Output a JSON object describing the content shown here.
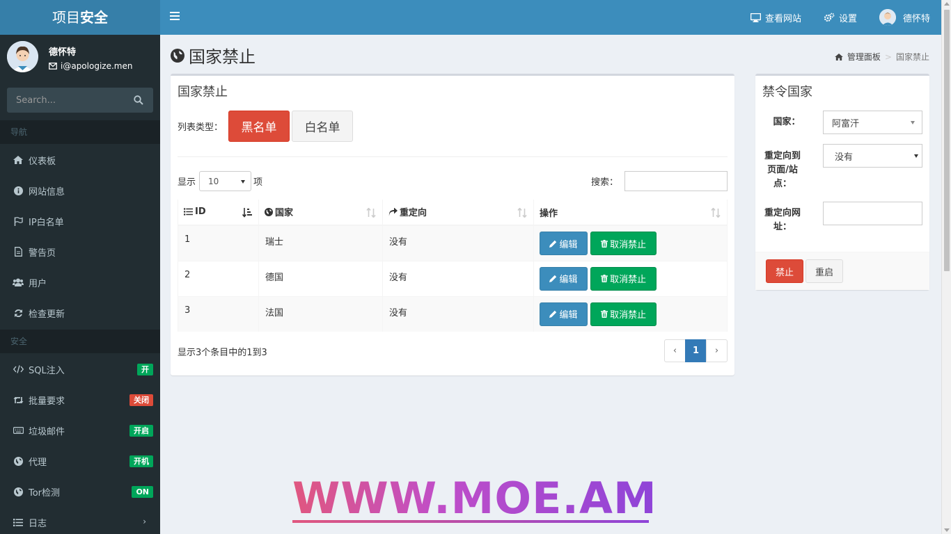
{
  "header": {
    "logo_light": "项目",
    "logo_bold": "安全",
    "view_site": "查看网站",
    "settings": "设置",
    "user_name": "德怀特"
  },
  "sidebar": {
    "user_name": "德怀特",
    "user_email": "i@apologize.men",
    "search_placeholder": "Search...",
    "nav_header": "导航",
    "security_header": "安全",
    "items": [
      {
        "label": "仪表板",
        "icon": "home-icon"
      },
      {
        "label": "网站信息",
        "icon": "info-icon"
      },
      {
        "label": "IP白名单",
        "icon": "flag-icon"
      },
      {
        "label": "警告页",
        "icon": "file-icon"
      },
      {
        "label": "用户",
        "icon": "users-icon"
      },
      {
        "label": "检查更新",
        "icon": "refresh-icon"
      }
    ],
    "security_items": [
      {
        "label": "SQL注入",
        "icon": "code-icon",
        "badge": "开",
        "badge_color": "#00a65a"
      },
      {
        "label": "批量要求",
        "icon": "retweet-icon",
        "badge": "关闭",
        "badge_color": "#dd4b39"
      },
      {
        "label": "垃圾邮件",
        "icon": "keyboard-icon",
        "badge": "开启",
        "badge_color": "#00a65a"
      },
      {
        "label": "代理",
        "icon": "globe-icon",
        "badge": "开机",
        "badge_color": "#00a65a"
      },
      {
        "label": "Tor检测",
        "icon": "globe-icon",
        "badge": "ON",
        "badge_color": "#00a65a"
      },
      {
        "label": "日志",
        "icon": "list-icon"
      }
    ]
  },
  "page": {
    "title": "国家禁止",
    "breadcrumb_home": "管理面板",
    "breadcrumb_current": "国家禁止"
  },
  "list_box": {
    "title": "国家禁止",
    "list_type_label": "列表类型：",
    "blacklist_label": "黑名单",
    "whitelist_label": "白名单",
    "show_label": "显示",
    "page_size": "10",
    "items_label": "项",
    "search_label": "搜索：",
    "search_value": "",
    "columns": [
      "ID",
      "国家",
      "重定向",
      "操作"
    ],
    "rows": [
      {
        "id": "1",
        "country": "瑞士",
        "redirect": "没有"
      },
      {
        "id": "2",
        "country": "德国",
        "redirect": "没有"
      },
      {
        "id": "3",
        "country": "法国",
        "redirect": "没有"
      }
    ],
    "edit_label": "编辑",
    "unban_label": "取消禁止",
    "info": "显示3个条目中的1到3",
    "pager_prev": "‹",
    "pager_current": "1",
    "pager_next": "›"
  },
  "ban_box": {
    "title": "禁令国家",
    "country_label": "国家：",
    "country_value": "阿富汗",
    "redirect_label_1": "重定向到",
    "redirect_label_2": "页面/站",
    "redirect_label_3": "点：",
    "redirect_value": "没有",
    "url_label_1": "重定向网",
    "url_label_2": "址：",
    "url_value": "",
    "ban_button": "禁止",
    "reset_button": "重启"
  },
  "watermark": "WWW.MOE.AM"
}
